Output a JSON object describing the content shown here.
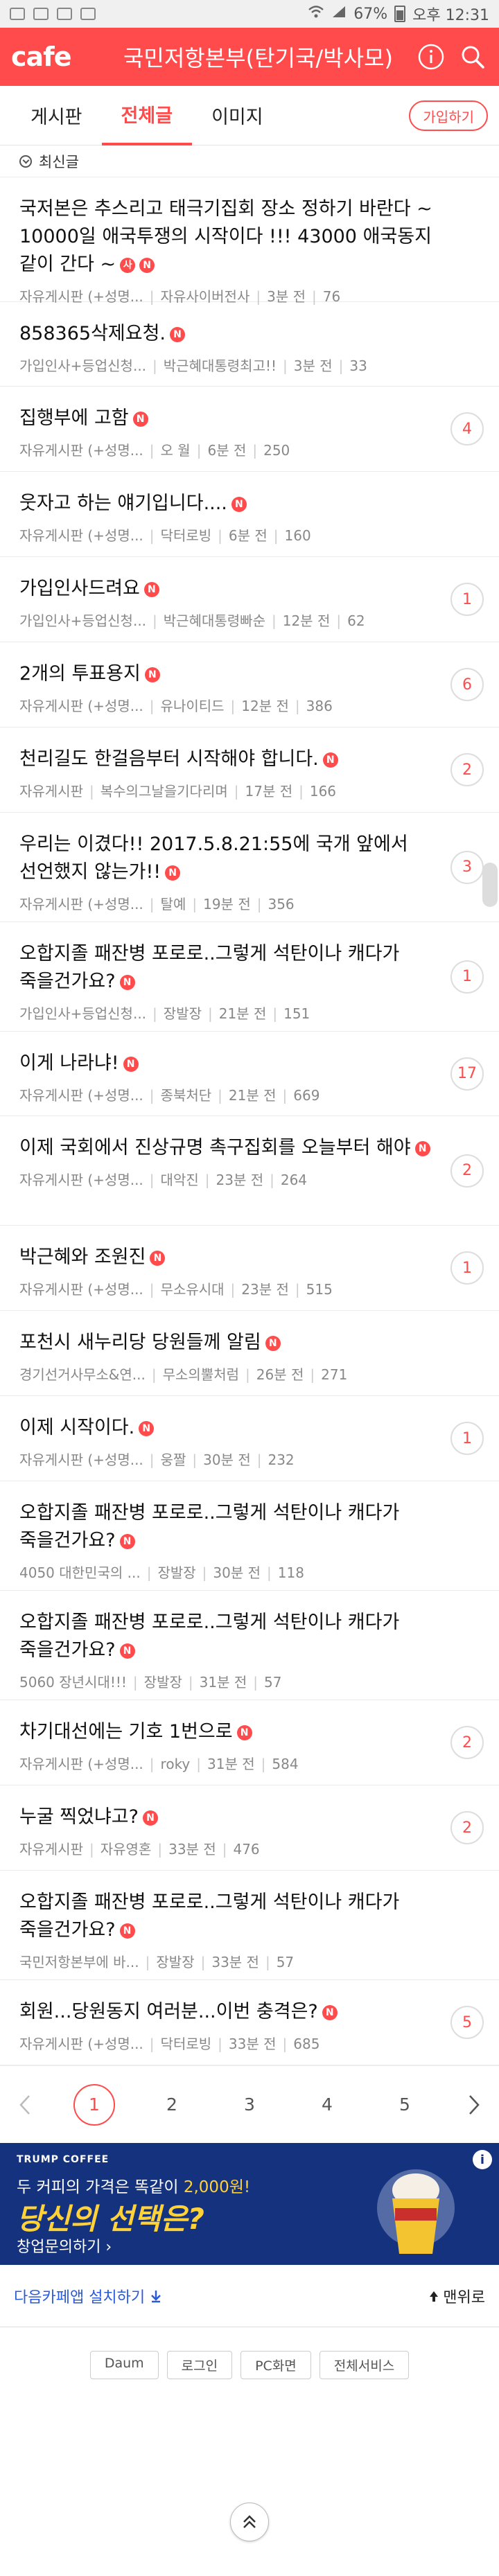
{
  "status_bar": {
    "battery": "67%",
    "time": "오후 12:31"
  },
  "header": {
    "logo": "cafe",
    "cafe_name": "국민저항본부(탄기국/박사모)"
  },
  "tabs": [
    {
      "label": "게시판"
    },
    {
      "label": "전체글"
    },
    {
      "label": "이미지"
    }
  ],
  "join_button": "가입하기",
  "sort_label": "최신글",
  "posts": [
    {
      "title": "국저본은 추스리고 태극기집회 장소 정하기 바란다 ~ 10000일 애국투쟁의 시작이다 !!! 43000 애국동지 같이 간다 ~",
      "badges": [
        "사",
        "N"
      ],
      "board": "자유게시판 (+성명...",
      "author": "자유사이버전사",
      "time": "3분 전",
      "views": "76",
      "comments": ""
    },
    {
      "title": "858365삭제요청.",
      "badges": [
        "N"
      ],
      "board": "가입인사+등업신청...",
      "author": "박근혜대통령최고!!",
      "time": "3분 전",
      "views": "33",
      "comments": ""
    },
    {
      "title": "집행부에 고함",
      "badges": [
        "N"
      ],
      "board": "자유게시판 (+성명...",
      "author": "오 월",
      "time": "6분 전",
      "views": "250",
      "comments": "4"
    },
    {
      "title": "웃자고 하는 얘기입니다....",
      "badges": [
        "N"
      ],
      "board": "자유게시판 (+성명...",
      "author": "닥터로빙",
      "time": "6분 전",
      "views": "160",
      "comments": ""
    },
    {
      "title": "가입인사드려요",
      "badges": [
        "N"
      ],
      "board": "가입인사+등업신청...",
      "author": "박근혜대통령빠순",
      "time": "12분 전",
      "views": "62",
      "comments": "1"
    },
    {
      "title": "2개의 투표용지",
      "badges": [
        "N"
      ],
      "board": "자유게시판 (+성명...",
      "author": "유나이티드",
      "time": "12분 전",
      "views": "386",
      "comments": "6"
    },
    {
      "title": "천리길도 한걸음부터 시작해야 합니다.",
      "badges": [
        "N"
      ],
      "board": "자유게시판",
      "author": "복수의그날을기다리며",
      "time": "17분 전",
      "views": "166",
      "comments": "2"
    },
    {
      "title": "우리는 이겼다!! 2017.5.8.21:55에 국개 앞에서 선언했지 않는가!!",
      "badges": [
        "N"
      ],
      "board": "자유게시판 (+성명...",
      "author": "탈예",
      "time": "19분 전",
      "views": "356",
      "comments": "3"
    },
    {
      "title": "오합지졸 패잔병 포로로..그렇게 석탄이나 캐다가 죽을건가요?",
      "badges": [
        "N"
      ],
      "board": "가입인사+등업신청...",
      "author": "장발장",
      "time": "21분 전",
      "views": "151",
      "comments": "1"
    },
    {
      "title": "이게 나라냐!",
      "badges": [
        "N"
      ],
      "board": "자유게시판 (+성명...",
      "author": "종북처단",
      "time": "21분 전",
      "views": "669",
      "comments": "17"
    },
    {
      "title": "이제 국회에서 진상규명 촉구집회를 오늘부터 해야",
      "badges": [
        "N"
      ],
      "board": "자유게시판 (+성명...",
      "author": "대악진",
      "time": "23분 전",
      "views": "264",
      "comments": "2"
    },
    {
      "title": "박근혜와 조원진",
      "badges": [
        "N"
      ],
      "board": "자유게시판 (+성명...",
      "author": "무소유시대",
      "time": "23분 전",
      "views": "515",
      "comments": "1"
    },
    {
      "title": "포천시 새누리당 당원들께 알림",
      "badges": [
        "N"
      ],
      "board": "경기선거사무소&연...",
      "author": "무소의뿔처럼",
      "time": "26분 전",
      "views": "271",
      "comments": ""
    },
    {
      "title": "이제 시작이다.",
      "badges": [
        "N"
      ],
      "board": "자유게시판 (+성명...",
      "author": "웅짤",
      "time": "30분 전",
      "views": "232",
      "comments": "1"
    },
    {
      "title": "오합지졸 패잔병 포로로..그렇게 석탄이나 캐다가 죽을건가요?",
      "badges": [
        "N"
      ],
      "board": "4050 대한민국의 ...",
      "author": "장발장",
      "time": "30분 전",
      "views": "118",
      "comments": ""
    },
    {
      "title": "오합지졸 패잔병 포로로..그렇게 석탄이나 캐다가 죽을건가요?",
      "badges": [
        "N"
      ],
      "board": "5060 장년시대!!!",
      "author": "장발장",
      "time": "31분 전",
      "views": "57",
      "comments": ""
    },
    {
      "title": "차기대선에는 기호 1번으로",
      "badges": [
        "N"
      ],
      "board": "자유게시판 (+성명...",
      "author": "roky",
      "time": "31분 전",
      "views": "584",
      "comments": "2"
    },
    {
      "title": "누굴 찍었냐고?",
      "badges": [
        "N"
      ],
      "board": "자유게시판",
      "author": "자유영혼",
      "time": "33분 전",
      "views": "476",
      "comments": "2"
    },
    {
      "title": "오합지졸 패잔병 포로로..그렇게 석탄이나 캐다가 죽을건가요?",
      "badges": [
        "N"
      ],
      "board": "국민저항본부에 바...",
      "author": "장발장",
      "time": "33분 전",
      "views": "57",
      "comments": ""
    },
    {
      "title": "회원...당원동지 여러분...이번 충격은?",
      "badges": [
        "N"
      ],
      "board": "자유게시판 (+성명...",
      "author": "닥터로빙",
      "time": "33분 전",
      "views": "685",
      "comments": "5"
    }
  ],
  "pagination": {
    "pages": [
      "1",
      "2",
      "3",
      "4",
      "5"
    ],
    "current": "1"
  },
  "ad": {
    "brand": "TRUMP COFFEE",
    "line1_prefix": "두 커피",
    "line1_mid": "의 가격은 똑같이 ",
    "line1_price": "2,000원!",
    "headline": "당신의 선택은?",
    "cta": "창업문의하기 ›",
    "info": "i"
  },
  "footer": {
    "install": "다음카페앱 설치하기",
    "menu": "맨위로"
  },
  "bottom_links": [
    "Daum",
    "로그인",
    "PC화면",
    "전체서비스"
  ],
  "colors": {
    "brand": "#ff4b4b",
    "ad_bg": "#15327e",
    "ad_accent": "#ffd23a"
  }
}
